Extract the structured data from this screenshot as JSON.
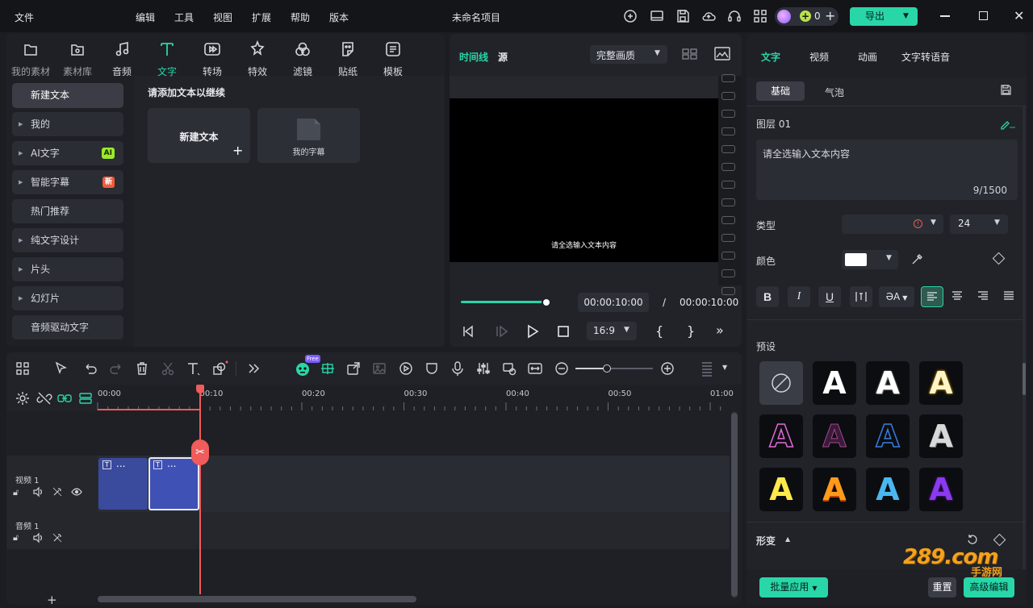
{
  "menubar": {
    "items": [
      "文件",
      "编辑",
      "工具",
      "视图",
      "扩展",
      "帮助",
      "版本"
    ],
    "app_title": "未命名项目",
    "credits_count": "0",
    "export_label": "导出"
  },
  "media_tabs": [
    "我的素材",
    "素材库",
    "音频",
    "文字",
    "转场",
    "特效",
    "滤镜",
    "贴纸",
    "模板"
  ],
  "sidebar": {
    "new_text": "新建文本",
    "categories": [
      {
        "label": "我的",
        "arrow": true
      },
      {
        "label": "AI文字",
        "arrow": true,
        "badge": "AI",
        "badge_color": "#9bea2a"
      },
      {
        "label": "智能字幕",
        "arrow": true,
        "badge": "新",
        "badge_color": "#f05b3a"
      },
      {
        "label": "热门推荐",
        "arrow": false
      },
      {
        "label": "纯文字设计",
        "arrow": true
      },
      {
        "label": "片头",
        "arrow": true
      },
      {
        "label": "幻灯片",
        "arrow": true
      },
      {
        "label": "音频驱动文字",
        "arrow": false
      }
    ]
  },
  "text_area": {
    "hint": "请添加文本以继续",
    "new_text_card": "新建文本",
    "my_subtitles_card": "我的字幕"
  },
  "preview": {
    "tab_timeline": "时间线",
    "tab_source": "源",
    "quality": "完整画质",
    "overlay_text": "请全选输入文本内容",
    "current_time": "00:00:10:00",
    "separator": "/",
    "total_time": "00:00:10:00",
    "aspect": "16:9",
    "progress": 1.0
  },
  "timeline": {
    "ruler_labels": [
      "00:00",
      "00:10",
      "00:20",
      "00:30",
      "00:40",
      "00:50",
      "01:00"
    ],
    "video_track": "视频 1",
    "audio_track": "音频 1",
    "clip_label": "...",
    "free_badge": "Free",
    "add_track": "+"
  },
  "right_panel": {
    "tabs": [
      "文字",
      "视频",
      "动画",
      "文字转语音"
    ],
    "subtabs": [
      "基础",
      "气泡"
    ],
    "layer": "图层 01",
    "text_content": "请全选输入文本内容",
    "char_count": "9/1500",
    "type_label": "类型",
    "font_size": "24",
    "color_label": "颜色",
    "presets_label": "预设",
    "transform_label": "形变",
    "apply_label": "批量应用",
    "reset_label": "重置",
    "advanced_label": "高级编辑",
    "text_color": "#ffffff",
    "accent": "#29d6a8"
  },
  "watermark": {
    "text": "289.com",
    "sub": "手游网"
  }
}
